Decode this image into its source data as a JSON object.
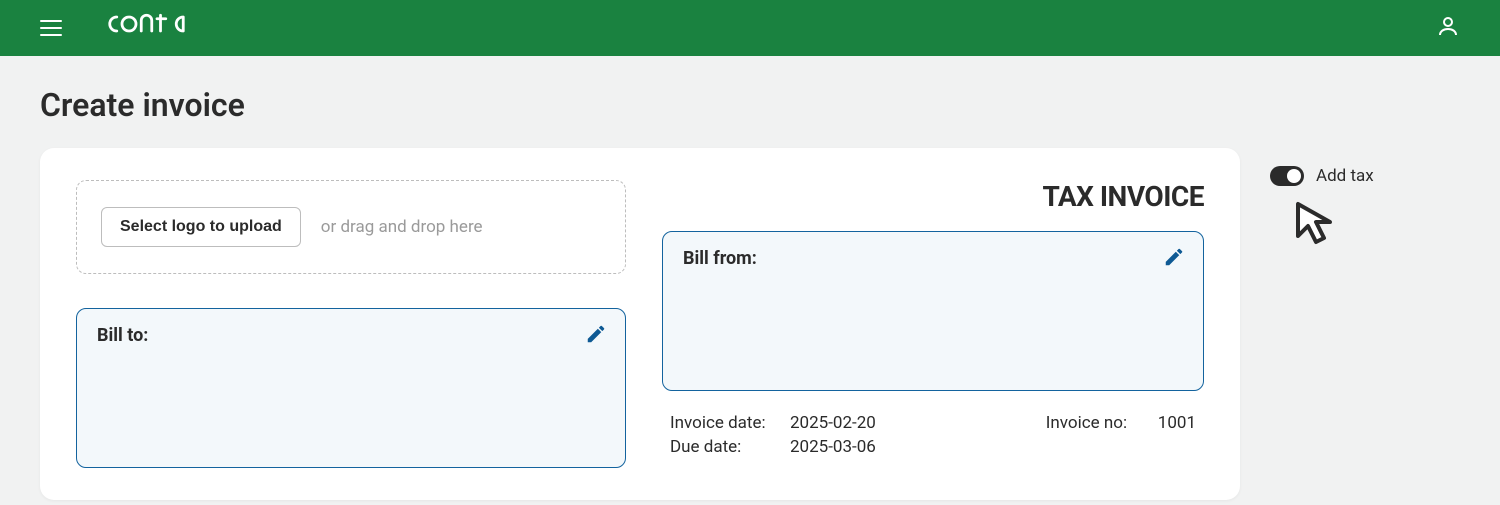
{
  "brand": "conta",
  "page": {
    "title": "Create invoice"
  },
  "invoice": {
    "heading": "TAX INVOICE",
    "logo_upload": {
      "button": "Select logo to upload",
      "drag_text": "or drag and drop here"
    },
    "bill_to_label": "Bill to:",
    "bill_from_label": "Bill from:",
    "meta": {
      "invoice_date_label": "Invoice date:",
      "invoice_date_value": "2025-02-20",
      "due_date_label": "Due date:",
      "due_date_value": "2025-03-06",
      "invoice_no_label": "Invoice no:",
      "invoice_no_value": "1001"
    }
  },
  "controls": {
    "add_tax_label": "Add tax",
    "add_tax_on": true
  },
  "colors": {
    "header_bg": "#1a8240",
    "box_border": "#13639e",
    "box_bg": "#f3f8fb",
    "edit_icon": "#0e5a94"
  }
}
